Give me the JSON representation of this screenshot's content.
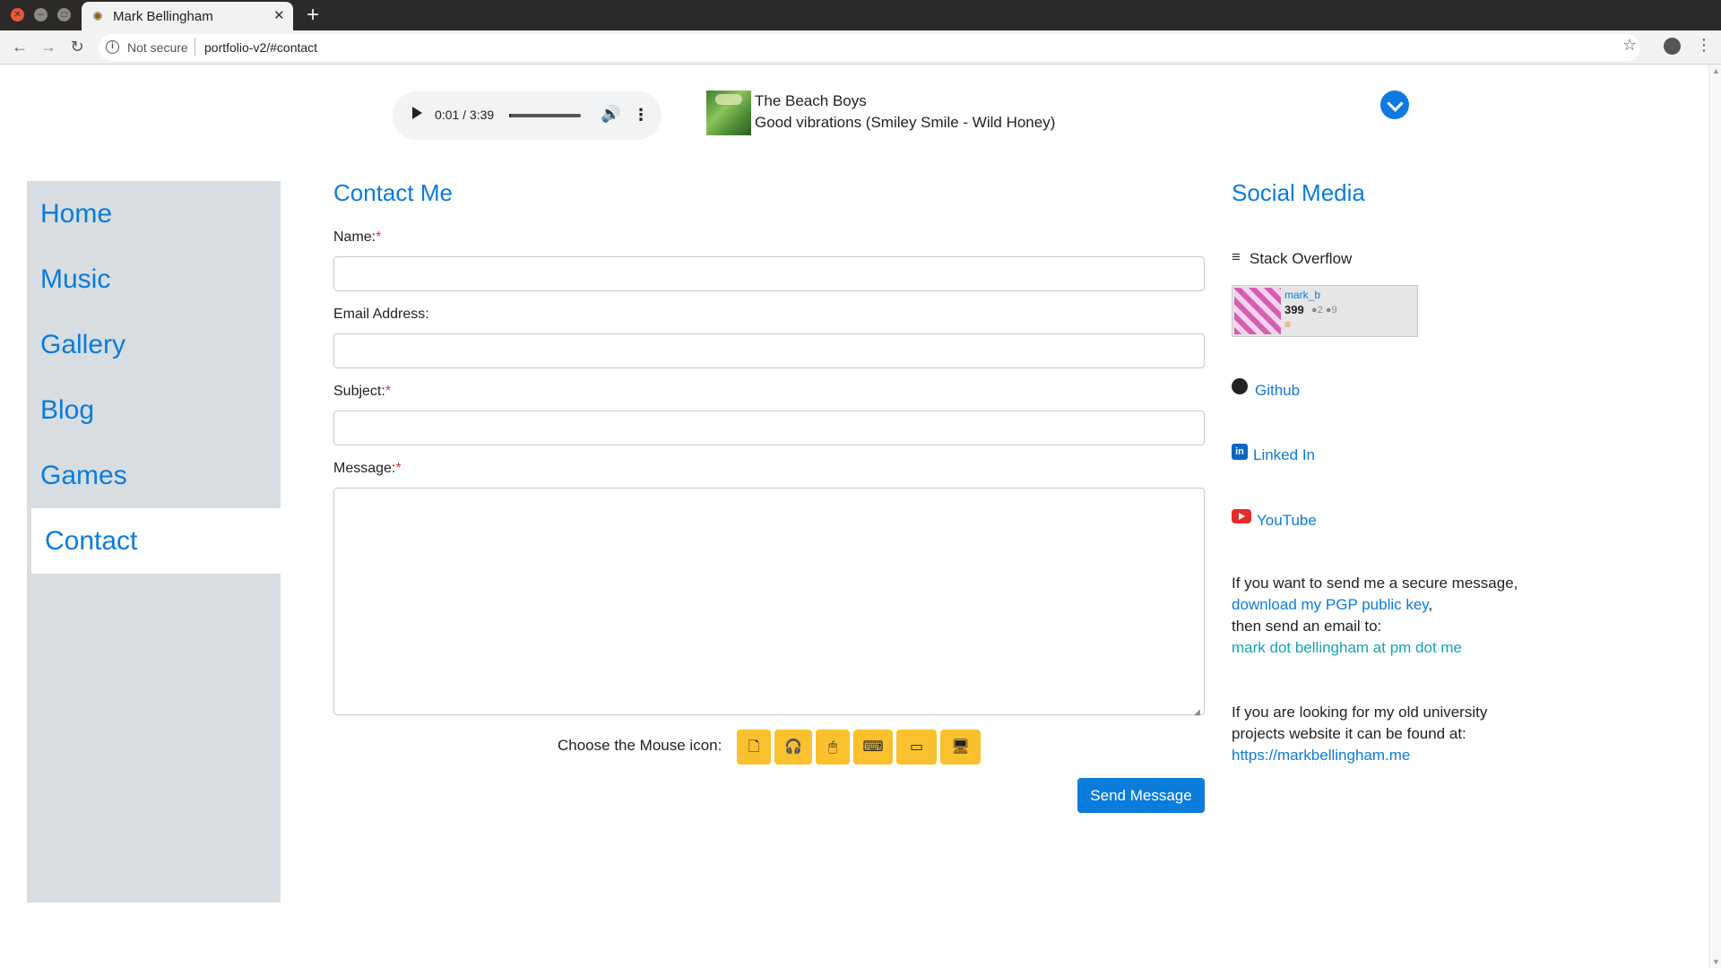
{
  "browser": {
    "tab_title": "Mark Bellingham",
    "security_label": "Not secure",
    "url": "portfolio-v2/#contact",
    "new_tab_glyph": "+",
    "tab_close_glyph": "✕"
  },
  "player": {
    "time": "0:01 / 3:39",
    "progress_fraction": 0.005,
    "artist": "The Beach Boys",
    "track": "Good vibrations (Smiley Smile - Wild Honey)"
  },
  "sidebar": {
    "items": [
      {
        "label": "Home",
        "active": false
      },
      {
        "label": "Music",
        "active": false
      },
      {
        "label": "Gallery",
        "active": false
      },
      {
        "label": "Blog",
        "active": false
      },
      {
        "label": "Games",
        "active": false
      },
      {
        "label": "Contact",
        "active": true
      }
    ]
  },
  "form": {
    "title": "Contact Me",
    "name_label": "Name:",
    "email_label": "Email Address:",
    "subject_label": "Subject:",
    "message_label": "Message:",
    "required_mark": "*",
    "name_value": "",
    "email_value": "",
    "subject_value": "",
    "message_value": "",
    "icon_chooser_label": "Choose the Mouse icon:",
    "icon_options": [
      "file-icon",
      "headphones-icon",
      "mouse-icon",
      "keyboard-icon",
      "battery-icon",
      "monitor-icon"
    ],
    "submit_label": "Send Message"
  },
  "social": {
    "title": "Social Media",
    "stackoverflow_label": "Stack Overflow",
    "flair": {
      "username": "mark_b",
      "reputation": "399",
      "badges": "●2 ●9"
    },
    "github_label": "Github",
    "linkedin_label": "Linked In",
    "linkedin_glyph": "in",
    "youtube_label": "YouTube",
    "pgp": {
      "line1": "If you want to send me a secure message,",
      "link": "download my PGP public key",
      "comma": ",",
      "line2": "then send an email to:",
      "email": "mark dot bellingham at pm dot me"
    },
    "old_site": {
      "line1": "If you are looking for my old university",
      "line2": "projects website it can be found at:",
      "url": "https://markbellingham.me"
    }
  },
  "colors": {
    "accent": "#0a7cdc",
    "sidebar_bg": "#d8dde1",
    "icon_button": "#fbc02d",
    "required": "#dd3333",
    "teal_link": "#17a2b8"
  }
}
